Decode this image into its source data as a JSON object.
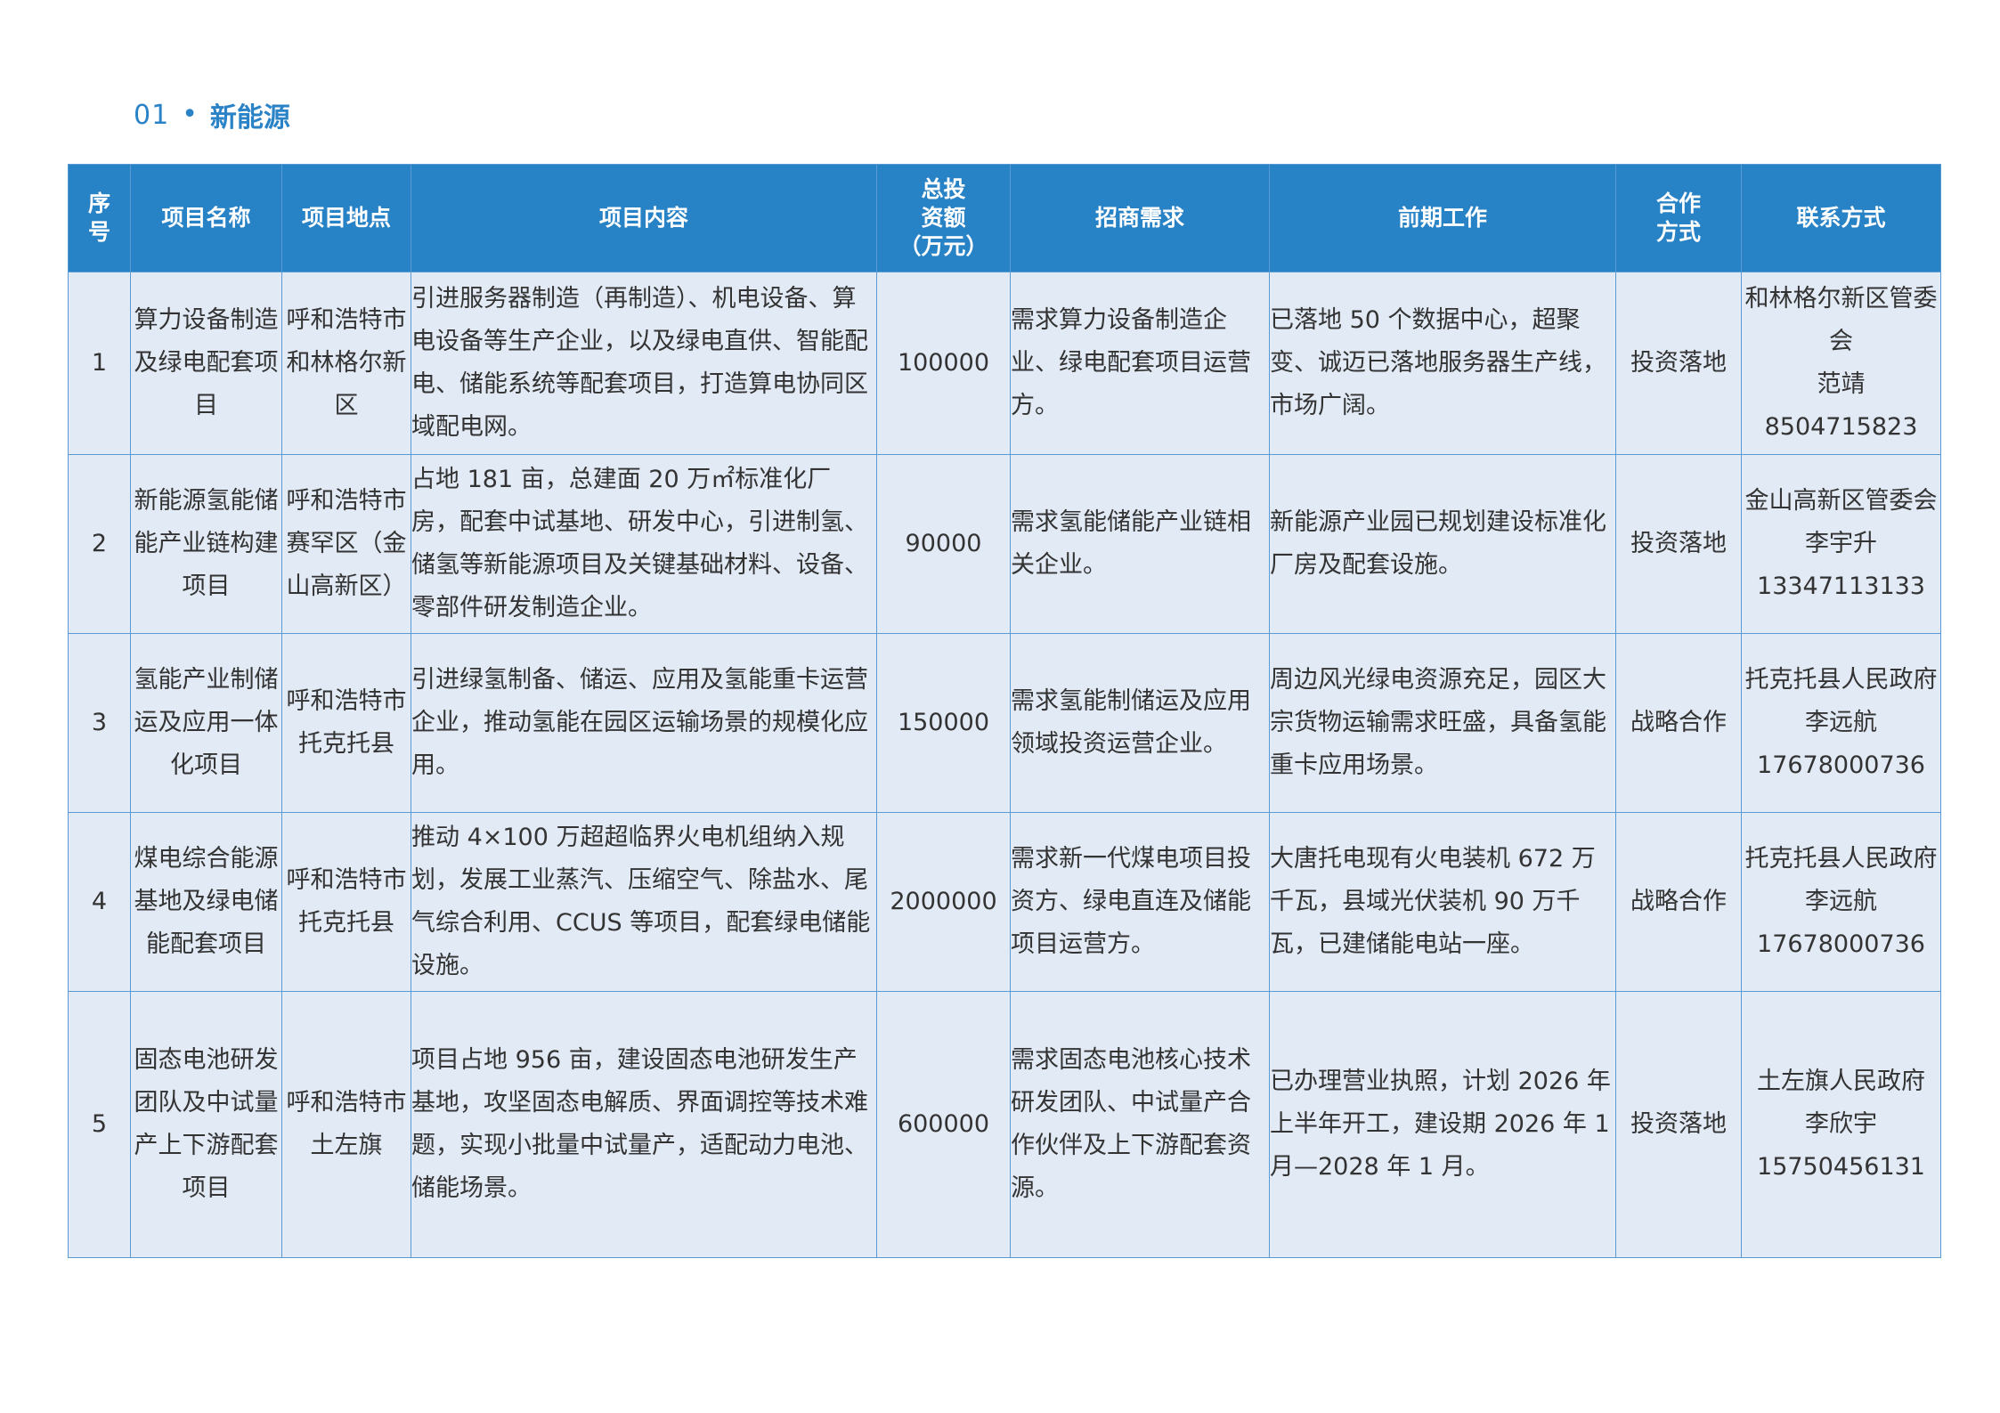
{
  "section": {
    "number": "01",
    "bullet": "•",
    "title": "新能源"
  },
  "table": {
    "headers": [
      {
        "lines": [
          "序",
          "号"
        ]
      },
      {
        "lines": [
          "项目名称"
        ]
      },
      {
        "lines": [
          "项目地点"
        ]
      },
      {
        "lines": [
          "项目内容"
        ]
      },
      {
        "lines": [
          "总投",
          "资额",
          "（万元）"
        ]
      },
      {
        "lines": [
          "招商需求"
        ]
      },
      {
        "lines": [
          "前期工作"
        ]
      },
      {
        "lines": [
          "合作",
          "方式"
        ]
      },
      {
        "lines": [
          "联系方式"
        ]
      }
    ],
    "rows": [
      {
        "index": "1",
        "name": "算力设备制造及绿电配套项目",
        "location": "呼和浩特市和林格尔新区",
        "content": "引进服务器制造（再制造）、机电设备、算电设备等生产企业，以及绿电直供、智能配电、储能系统等配套项目，打造算电协同区域配电网。",
        "investment": "100000",
        "demand": "需求算力设备制造企业、绿电配套项目运营方。",
        "preliminary": "已落地 50 个数据中心，超聚变、诚迈已落地服务器生产线，市场广阔。",
        "cooperation": "投资落地",
        "contact": [
          "和林格尔新区管委会",
          "范靖",
          "8504715823"
        ]
      },
      {
        "index": "2",
        "name": "新能源氢能储能产业链构建项目",
        "location": "呼和浩特市赛罕区（金山高新区）",
        "content": "占地 181 亩，总建面 20 万㎡标准化厂房，配套中试基地、研发中心，引进制氢、储氢等新能源项目及关键基础材料、设备、零部件研发制造企业。",
        "investment": "90000",
        "demand": "需求氢能储能产业链相关企业。",
        "preliminary": "新能源产业园已规划建设标准化厂房及配套设施。",
        "cooperation": "投资落地",
        "contact": [
          "金山高新区管委会",
          "李宇升",
          "13347113133"
        ]
      },
      {
        "index": "3",
        "name": "氢能产业制储运及应用一体化项目",
        "location": "呼和浩特市托克托县",
        "content": "引进绿氢制备、储运、应用及氢能重卡运营企业，推动氢能在园区运输场景的规模化应用。",
        "investment": "150000",
        "demand": "需求氢能制储运及应用领域投资运营企业。",
        "preliminary": "周边风光绿电资源充足，园区大宗货物运输需求旺盛，具备氢能重卡应用场景。",
        "cooperation": "战略合作",
        "contact": [
          "托克托县人民政府",
          "李远航",
          "17678000736"
        ]
      },
      {
        "index": "4",
        "name": "煤电综合能源基地及绿电储能配套项目",
        "location": "呼和浩特市托克托县",
        "content": "推动 4×100 万超超临界火电机组纳入规划，发展工业蒸汽、压缩空气、除盐水、尾气综合利用、CCUS 等项目，配套绿电储能设施。",
        "investment": "2000000",
        "demand": "需求新一代煤电项目投资方、绿电直连及储能项目运营方。",
        "preliminary": "大唐托电现有火电装机 672 万千瓦，县域光伏装机 90 万千瓦，已建储能电站一座。",
        "cooperation": "战略合作",
        "contact": [
          "托克托县人民政府",
          "李远航",
          "17678000736"
        ]
      },
      {
        "index": "5",
        "name": "固态电池研发团队及中试量产上下游配套项目",
        "location": "呼和浩特市土左旗",
        "content": "项目占地 956 亩，建设固态电池研发生产基地，攻坚固态电解质、界面调控等技术难题，实现小批量中试量产，适配动力电池、储能场景。",
        "investment": "600000",
        "demand": "需求固态电池核心技术研发团队、中试量产合作伙伴及上下游配套资源。",
        "preliminary": "已办理营业执照，计划 2026 年上半年开工，建设期 2026 年 1 月—2028 年 1 月。",
        "cooperation": "投资落地",
        "contact": [
          "土左旗人民政府",
          "李欣宇",
          "15750456131"
        ]
      }
    ]
  }
}
